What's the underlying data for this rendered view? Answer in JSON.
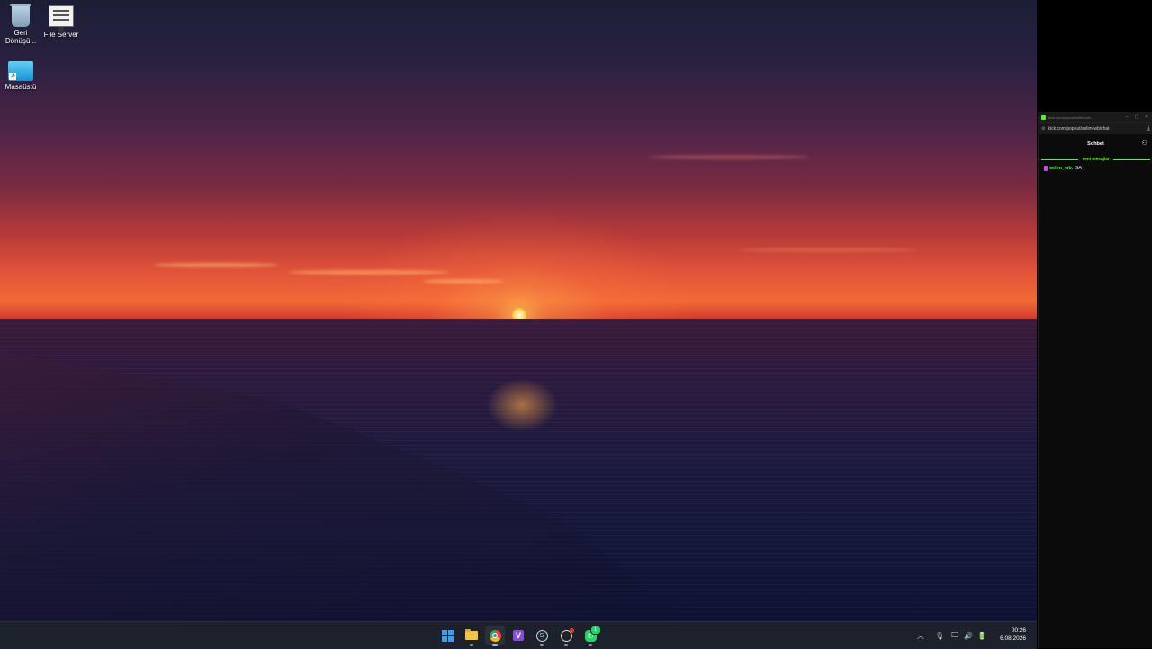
{
  "desktop": {
    "icons": [
      {
        "label": "Geri Dönüşü...",
        "icon": "recycle-bin-icon"
      },
      {
        "label": "File Server",
        "icon": "monitor-icon"
      },
      {
        "label": "Masaüstü",
        "icon": "desktop-shortcut-icon"
      }
    ]
  },
  "chat_window": {
    "title": "kick.com/popout/selim-wb/...",
    "url": "kick.com/popout/selim-wb/chat",
    "header_title": "Sohbet",
    "new_messages_label": "Yeni mesajlar",
    "messages": [
      {
        "user": "selim_wb:",
        "text": "SA",
        "badge_color": "#c04de8"
      }
    ],
    "accent_color": "#53fc18",
    "controls": {
      "minimize": "–",
      "maximize": "▢",
      "close": "✕"
    }
  },
  "taskbar": {
    "apps": [
      {
        "name": "start",
        "icon": "windows-start-icon"
      },
      {
        "name": "file-explorer",
        "icon": "folder-icon"
      },
      {
        "name": "chrome",
        "icon": "chrome-icon",
        "active": true
      },
      {
        "name": "visual-studio",
        "icon": "visual-studio-icon",
        "glyph": "V"
      },
      {
        "name": "steam",
        "icon": "steam-icon",
        "glyph": "S"
      },
      {
        "name": "obs",
        "icon": "obs-icon"
      },
      {
        "name": "whatsapp",
        "icon": "whatsapp-icon",
        "badge": "1"
      }
    ],
    "tray": {
      "chevron": "︿",
      "mic": "🎙",
      "network": "🖵",
      "volume": "🔊",
      "battery": "🔋"
    },
    "clock": {
      "time": "00:26",
      "date": "6.08.2026"
    }
  }
}
